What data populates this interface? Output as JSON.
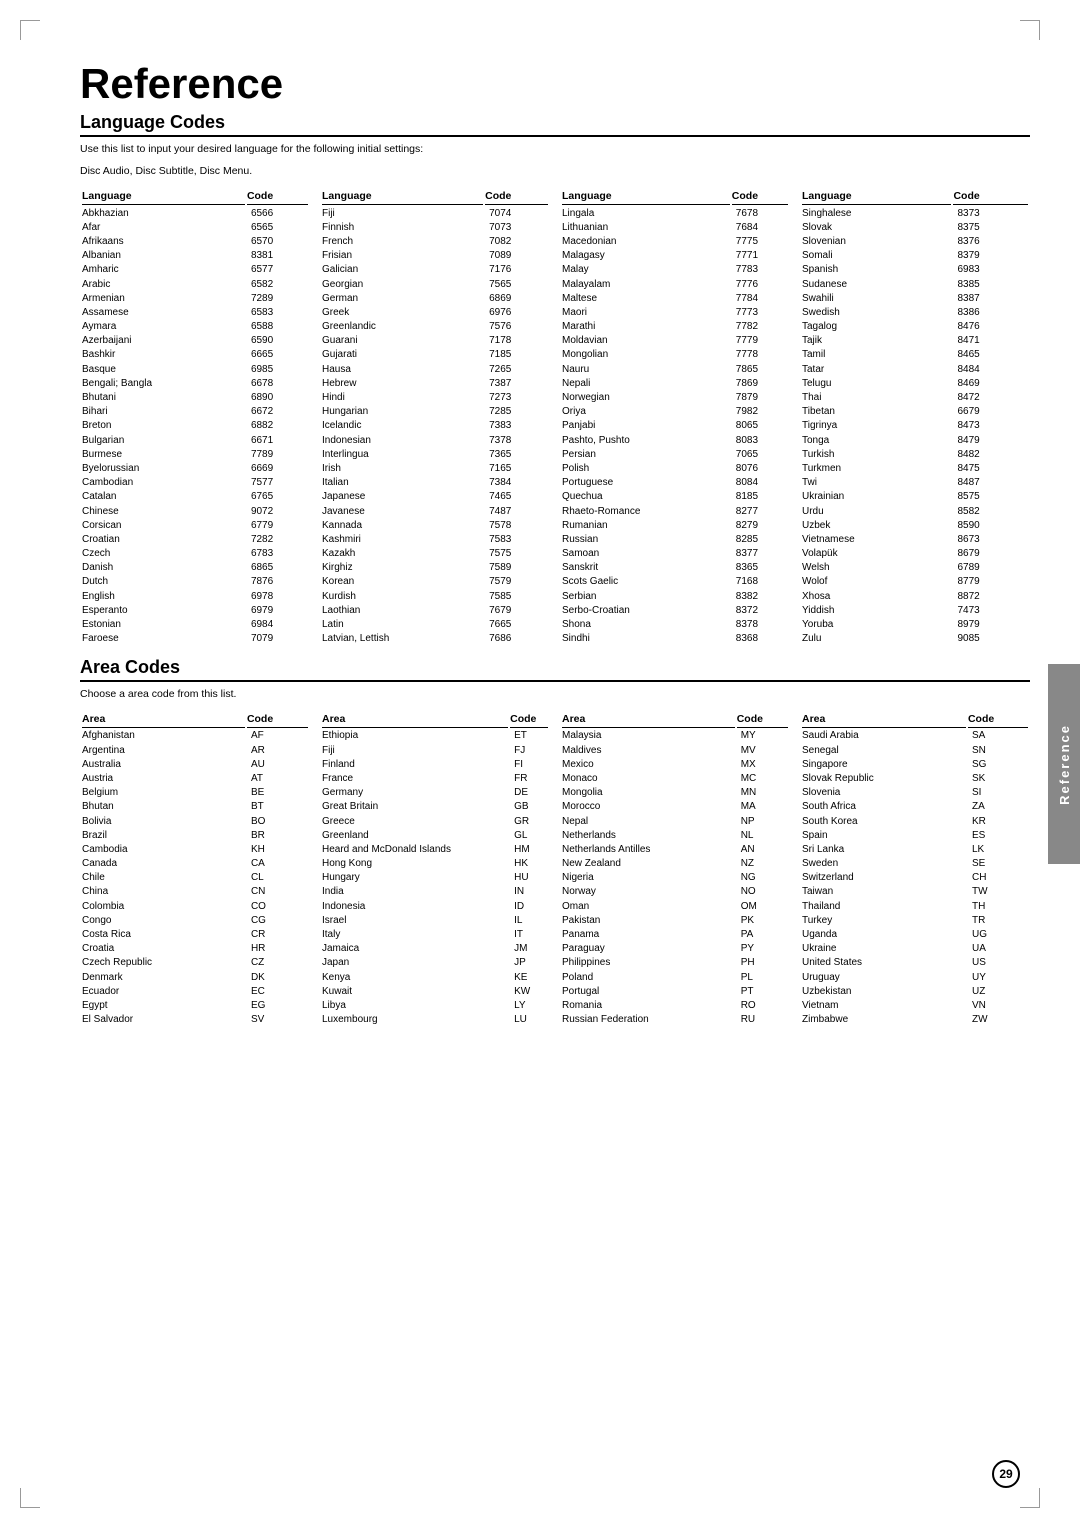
{
  "page": {
    "title": "Reference",
    "page_number": "29",
    "side_tab": "Reference"
  },
  "language_codes": {
    "heading": "Language Codes",
    "description": "Use this list to input your desired language for the following initial settings:",
    "description2": "Disc Audio, Disc Subtitle, Disc Menu.",
    "col1_header_lang": "Language",
    "col1_header_code": "Code",
    "columns": [
      [
        [
          "Abkhazian",
          "6566"
        ],
        [
          "Afar",
          "6565"
        ],
        [
          "Afrikaans",
          "6570"
        ],
        [
          "Albanian",
          "8381"
        ],
        [
          "Amharic",
          "6577"
        ],
        [
          "Arabic",
          "6582"
        ],
        [
          "Armenian",
          "7289"
        ],
        [
          "Assamese",
          "6583"
        ],
        [
          "Aymara",
          "6588"
        ],
        [
          "Azerbaijani",
          "6590"
        ],
        [
          "Bashkir",
          "6665"
        ],
        [
          "Basque",
          "6985"
        ],
        [
          "Bengali; Bangla",
          "6678"
        ],
        [
          "Bhutani",
          "6890"
        ],
        [
          "Bihari",
          "6672"
        ],
        [
          "Breton",
          "6882"
        ],
        [
          "Bulgarian",
          "6671"
        ],
        [
          "Burmese",
          "7789"
        ],
        [
          "Byelorussian",
          "6669"
        ],
        [
          "Cambodian",
          "7577"
        ],
        [
          "Catalan",
          "6765"
        ],
        [
          "Chinese",
          "9072"
        ],
        [
          "Corsican",
          "6779"
        ],
        [
          "Croatian",
          "7282"
        ],
        [
          "Czech",
          "6783"
        ],
        [
          "Danish",
          "6865"
        ],
        [
          "Dutch",
          "7876"
        ],
        [
          "English",
          "6978"
        ],
        [
          "Esperanto",
          "6979"
        ],
        [
          "Estonian",
          "6984"
        ],
        [
          "Faroese",
          "7079"
        ]
      ],
      [
        [
          "Fiji",
          "7074"
        ],
        [
          "Finnish",
          "7073"
        ],
        [
          "French",
          "7082"
        ],
        [
          "Frisian",
          "7089"
        ],
        [
          "Galician",
          "7176"
        ],
        [
          "Georgian",
          "7565"
        ],
        [
          "German",
          "6869"
        ],
        [
          "Greek",
          "6976"
        ],
        [
          "Greenlandic",
          "7576"
        ],
        [
          "Guarani",
          "7178"
        ],
        [
          "Gujarati",
          "7185"
        ],
        [
          "Hausa",
          "7265"
        ],
        [
          "Hebrew",
          "7387"
        ],
        [
          "Hindi",
          "7273"
        ],
        [
          "Hungarian",
          "7285"
        ],
        [
          "Icelandic",
          "7383"
        ],
        [
          "Indonesian",
          "7378"
        ],
        [
          "Interlingua",
          "7365"
        ],
        [
          "Irish",
          "7165"
        ],
        [
          "Italian",
          "7384"
        ],
        [
          "Japanese",
          "7465"
        ],
        [
          "Javanese",
          "7487"
        ],
        [
          "Kannada",
          "7578"
        ],
        [
          "Kashmiri",
          "7583"
        ],
        [
          "Kazakh",
          "7575"
        ],
        [
          "Kirghiz",
          "7589"
        ],
        [
          "Korean",
          "7579"
        ],
        [
          "Kurdish",
          "7585"
        ],
        [
          "Laothian",
          "7679"
        ],
        [
          "Latin",
          "7665"
        ],
        [
          "Latvian, Lettish",
          "7686"
        ]
      ],
      [
        [
          "Lingala",
          "7678"
        ],
        [
          "Lithuanian",
          "7684"
        ],
        [
          "Macedonian",
          "7775"
        ],
        [
          "Malagasy",
          "7771"
        ],
        [
          "Malay",
          "7783"
        ],
        [
          "Malayalam",
          "7776"
        ],
        [
          "Maltese",
          "7784"
        ],
        [
          "Maori",
          "7773"
        ],
        [
          "Marathi",
          "7782"
        ],
        [
          "Moldavian",
          "7779"
        ],
        [
          "Mongolian",
          "7778"
        ],
        [
          "Nauru",
          "7865"
        ],
        [
          "Nepali",
          "7869"
        ],
        [
          "Norwegian",
          "7879"
        ],
        [
          "Oriya",
          "7982"
        ],
        [
          "Panjabi",
          "8065"
        ],
        [
          "Pashto, Pushto",
          "8083"
        ],
        [
          "Persian",
          "7065"
        ],
        [
          "Polish",
          "8076"
        ],
        [
          "Portuguese",
          "8084"
        ],
        [
          "Quechua",
          "8185"
        ],
        [
          "Rhaeto-Romance",
          "8277"
        ],
        [
          "Rumanian",
          "8279"
        ],
        [
          "Russian",
          "8285"
        ],
        [
          "Samoan",
          "8377"
        ],
        [
          "Sanskrit",
          "8365"
        ],
        [
          "Scots Gaelic",
          "7168"
        ],
        [
          "Serbian",
          "8382"
        ],
        [
          "Serbo-Croatian",
          "8372"
        ],
        [
          "Shona",
          "8378"
        ],
        [
          "Sindhi",
          "8368"
        ]
      ],
      [
        [
          "Singhalese",
          "8373"
        ],
        [
          "Slovak",
          "8375"
        ],
        [
          "Slovenian",
          "8376"
        ],
        [
          "Somali",
          "8379"
        ],
        [
          "Spanish",
          "6983"
        ],
        [
          "Sudanese",
          "8385"
        ],
        [
          "Swahili",
          "8387"
        ],
        [
          "Swedish",
          "8386"
        ],
        [
          "Tagalog",
          "8476"
        ],
        [
          "Tajik",
          "8471"
        ],
        [
          "Tamil",
          "8465"
        ],
        [
          "Tatar",
          "8484"
        ],
        [
          "Telugu",
          "8469"
        ],
        [
          "Thai",
          "8472"
        ],
        [
          "Tibetan",
          "6679"
        ],
        [
          "Tigrinya",
          "8473"
        ],
        [
          "Tonga",
          "8479"
        ],
        [
          "Turkish",
          "8482"
        ],
        [
          "Turkmen",
          "8475"
        ],
        [
          "Twi",
          "8487"
        ],
        [
          "Ukrainian",
          "8575"
        ],
        [
          "Urdu",
          "8582"
        ],
        [
          "Uzbek",
          "8590"
        ],
        [
          "Vietnamese",
          "8673"
        ],
        [
          "Volapük",
          "8679"
        ],
        [
          "Welsh",
          "6789"
        ],
        [
          "Wolof",
          "8779"
        ],
        [
          "Xhosa",
          "8872"
        ],
        [
          "Yiddish",
          "7473"
        ],
        [
          "Yoruba",
          "8979"
        ],
        [
          "Zulu",
          "9085"
        ]
      ]
    ]
  },
  "area_codes": {
    "heading": "Area Codes",
    "description": "Choose a area code from this list.",
    "col1_header_area": "Area",
    "col1_header_code": "Code",
    "columns": [
      [
        [
          "Afghanistan",
          "AF"
        ],
        [
          "Argentina",
          "AR"
        ],
        [
          "Australia",
          "AU"
        ],
        [
          "Austria",
          "AT"
        ],
        [
          "Belgium",
          "BE"
        ],
        [
          "Bhutan",
          "BT"
        ],
        [
          "Bolivia",
          "BO"
        ],
        [
          "Brazil",
          "BR"
        ],
        [
          "Cambodia",
          "KH"
        ],
        [
          "Canada",
          "CA"
        ],
        [
          "Chile",
          "CL"
        ],
        [
          "China",
          "CN"
        ],
        [
          "Colombia",
          "CO"
        ],
        [
          "Congo",
          "CG"
        ],
        [
          "Costa Rica",
          "CR"
        ],
        [
          "Croatia",
          "HR"
        ],
        [
          "Czech Republic",
          "CZ"
        ],
        [
          "Denmark",
          "DK"
        ],
        [
          "Ecuador",
          "EC"
        ],
        [
          "Egypt",
          "EG"
        ],
        [
          "El Salvador",
          "SV"
        ]
      ],
      [
        [
          "Ethiopia",
          "ET"
        ],
        [
          "Fiji",
          "FJ"
        ],
        [
          "Finland",
          "FI"
        ],
        [
          "France",
          "FR"
        ],
        [
          "Germany",
          "DE"
        ],
        [
          "Great Britain",
          "GB"
        ],
        [
          "Greece",
          "GR"
        ],
        [
          "Greenland",
          "GL"
        ],
        [
          "Heard and McDonald Islands",
          "HM"
        ],
        [
          "Hong Kong",
          "HK"
        ],
        [
          "Hungary",
          "HU"
        ],
        [
          "India",
          "IN"
        ],
        [
          "Indonesia",
          "ID"
        ],
        [
          "Israel",
          "IL"
        ],
        [
          "Italy",
          "IT"
        ],
        [
          "Jamaica",
          "JM"
        ],
        [
          "Japan",
          "JP"
        ],
        [
          "Kenya",
          "KE"
        ],
        [
          "Kuwait",
          "KW"
        ],
        [
          "Libya",
          "LY"
        ],
        [
          "Luxembourg",
          "LU"
        ]
      ],
      [
        [
          "Malaysia",
          "MY"
        ],
        [
          "Maldives",
          "MV"
        ],
        [
          "Mexico",
          "MX"
        ],
        [
          "Monaco",
          "MC"
        ],
        [
          "Mongolia",
          "MN"
        ],
        [
          "Morocco",
          "MA"
        ],
        [
          "Nepal",
          "NP"
        ],
        [
          "Netherlands",
          "NL"
        ],
        [
          "Netherlands Antilles",
          "AN"
        ],
        [
          "New Zealand",
          "NZ"
        ],
        [
          "Nigeria",
          "NG"
        ],
        [
          "Norway",
          "NO"
        ],
        [
          "Oman",
          "OM"
        ],
        [
          "Pakistan",
          "PK"
        ],
        [
          "Panama",
          "PA"
        ],
        [
          "Paraguay",
          "PY"
        ],
        [
          "Philippines",
          "PH"
        ],
        [
          "Poland",
          "PL"
        ],
        [
          "Portugal",
          "PT"
        ],
        [
          "Romania",
          "RO"
        ],
        [
          "Russian Federation",
          "RU"
        ]
      ],
      [
        [
          "Saudi Arabia",
          "SA"
        ],
        [
          "Senegal",
          "SN"
        ],
        [
          "Singapore",
          "SG"
        ],
        [
          "Slovak Republic",
          "SK"
        ],
        [
          "Slovenia",
          "SI"
        ],
        [
          "South Africa",
          "ZA"
        ],
        [
          "South Korea",
          "KR"
        ],
        [
          "Spain",
          "ES"
        ],
        [
          "Sri Lanka",
          "LK"
        ],
        [
          "Sweden",
          "SE"
        ],
        [
          "Switzerland",
          "CH"
        ],
        [
          "Taiwan",
          "TW"
        ],
        [
          "Thailand",
          "TH"
        ],
        [
          "Turkey",
          "TR"
        ],
        [
          "Uganda",
          "UG"
        ],
        [
          "Ukraine",
          "UA"
        ],
        [
          "United States",
          "US"
        ],
        [
          "Uruguay",
          "UY"
        ],
        [
          "Uzbekistan",
          "UZ"
        ],
        [
          "Vietnam",
          "VN"
        ],
        [
          "Zimbabwe",
          "ZW"
        ]
      ]
    ]
  }
}
